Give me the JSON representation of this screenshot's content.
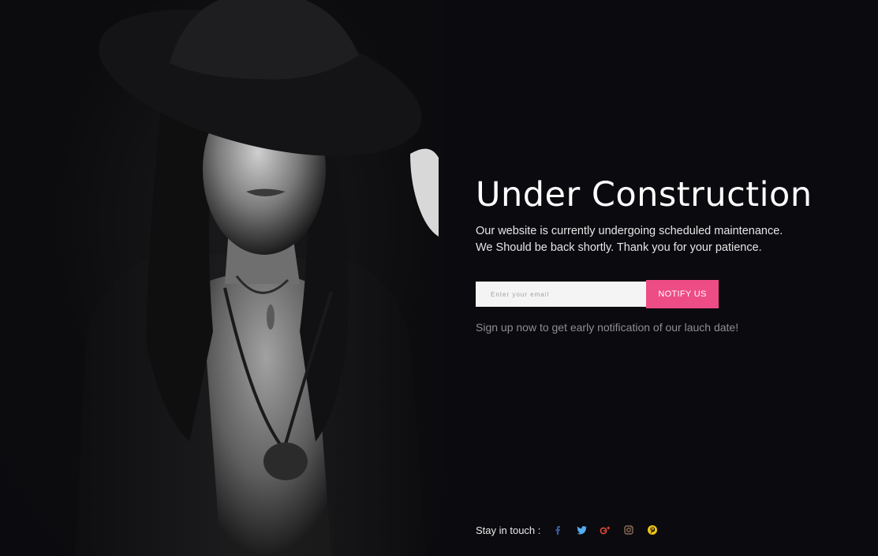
{
  "hero": {
    "title": "Under Construction",
    "description": "Our website is currently undergoing scheduled maintenance. We Should be back shortly. Thank you for your patience."
  },
  "signup": {
    "placeholder": "Enter your email",
    "button_label": "NOTIFY US",
    "note": "Sign up now to get early notification of our lauch date!"
  },
  "social": {
    "label": "Stay in touch :",
    "links": [
      {
        "icon": "facebook-icon",
        "color": "#3b5998"
      },
      {
        "icon": "twitter-icon",
        "color": "#55acee"
      },
      {
        "icon": "google-plus-icon",
        "color": "#dd4b39"
      },
      {
        "icon": "instagram-icon",
        "color": "#8a6d5a"
      },
      {
        "icon": "pinterest-icon",
        "color": "#f0c419"
      }
    ]
  },
  "colors": {
    "background": "#0b0a0e",
    "accent": "#ee4c84"
  }
}
